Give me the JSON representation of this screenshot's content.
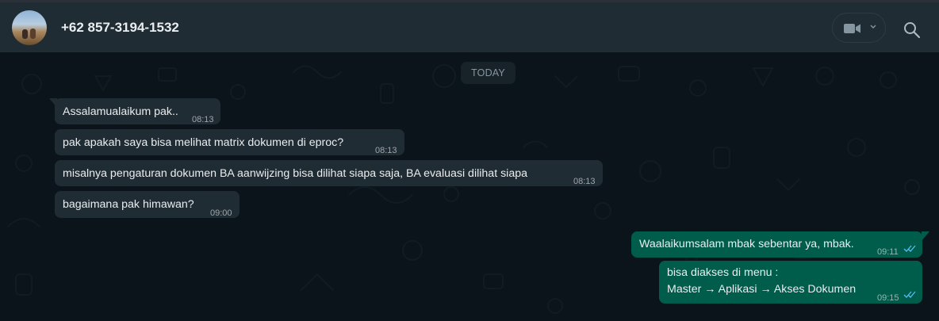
{
  "header": {
    "contact_name": "+62 857-3194-1532",
    "avatar_icon": "contact-avatar-photo",
    "video_call_icon": "video-camera-icon",
    "dropdown_icon": "chevron-down-icon",
    "search_icon": "search-icon"
  },
  "chat": {
    "date_separator": "TODAY",
    "messages": [
      {
        "direction": "incoming",
        "text": "Assalamualaikum pak..",
        "time": "08:13"
      },
      {
        "direction": "incoming",
        "text": "pak apakah saya bisa melihat matrix dokumen di eproc?",
        "time": "08:13"
      },
      {
        "direction": "incoming",
        "text": "misalnya pengaturan dokumen BA aanwijzing bisa dilihat siapa saja, BA evaluasi dilihat siapa",
        "time": "08:13"
      },
      {
        "direction": "incoming",
        "text": "bagaimana pak himawan?",
        "time": "09:00"
      },
      {
        "direction": "outgoing",
        "text": "Waalaikumsalam mbak sebentar ya, mbak.",
        "time": "09:11",
        "status": "read"
      },
      {
        "direction": "outgoing",
        "lines": [
          "bisa diakses di menu :",
          "Master → Aplikasi → Akses Dokumen"
        ],
        "time": "09:15",
        "status": "read"
      }
    ]
  },
  "colors": {
    "header_bg": "#202c33",
    "chat_bg": "#0b141a",
    "incoming_bubble": "#202c33",
    "outgoing_bubble": "#005c4b",
    "read_tick": "#53bdeb"
  }
}
